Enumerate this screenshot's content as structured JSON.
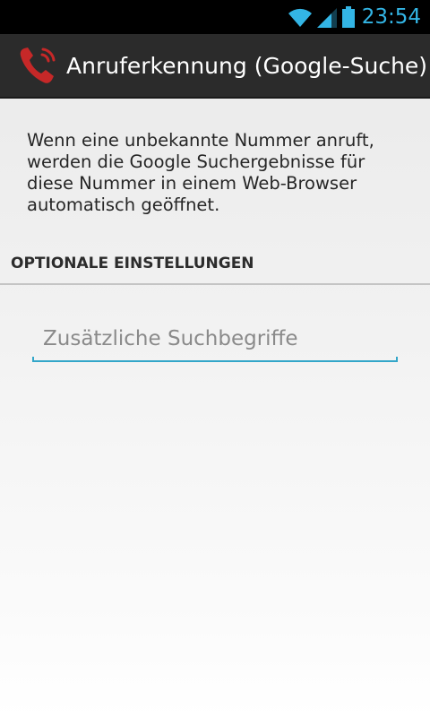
{
  "status_bar": {
    "time": "23:54",
    "icons": [
      "wifi-icon",
      "signal-icon",
      "battery-icon"
    ],
    "accent_color": "#33b5e5"
  },
  "action_bar": {
    "app_icon": "phone-icon",
    "title": "Anruferkennung (Google-Suche)"
  },
  "main": {
    "description": "Wenn eine unbekannte Nummer anruft, werden die Google Suchergebnisse für diese Nummer in einem Web-Browser automatisch geöffnet.",
    "section_header": "OPTIONALE EINSTELLUNGEN",
    "search_field": {
      "value": "",
      "placeholder": "Zusätzliche Suchbegriffe"
    }
  }
}
